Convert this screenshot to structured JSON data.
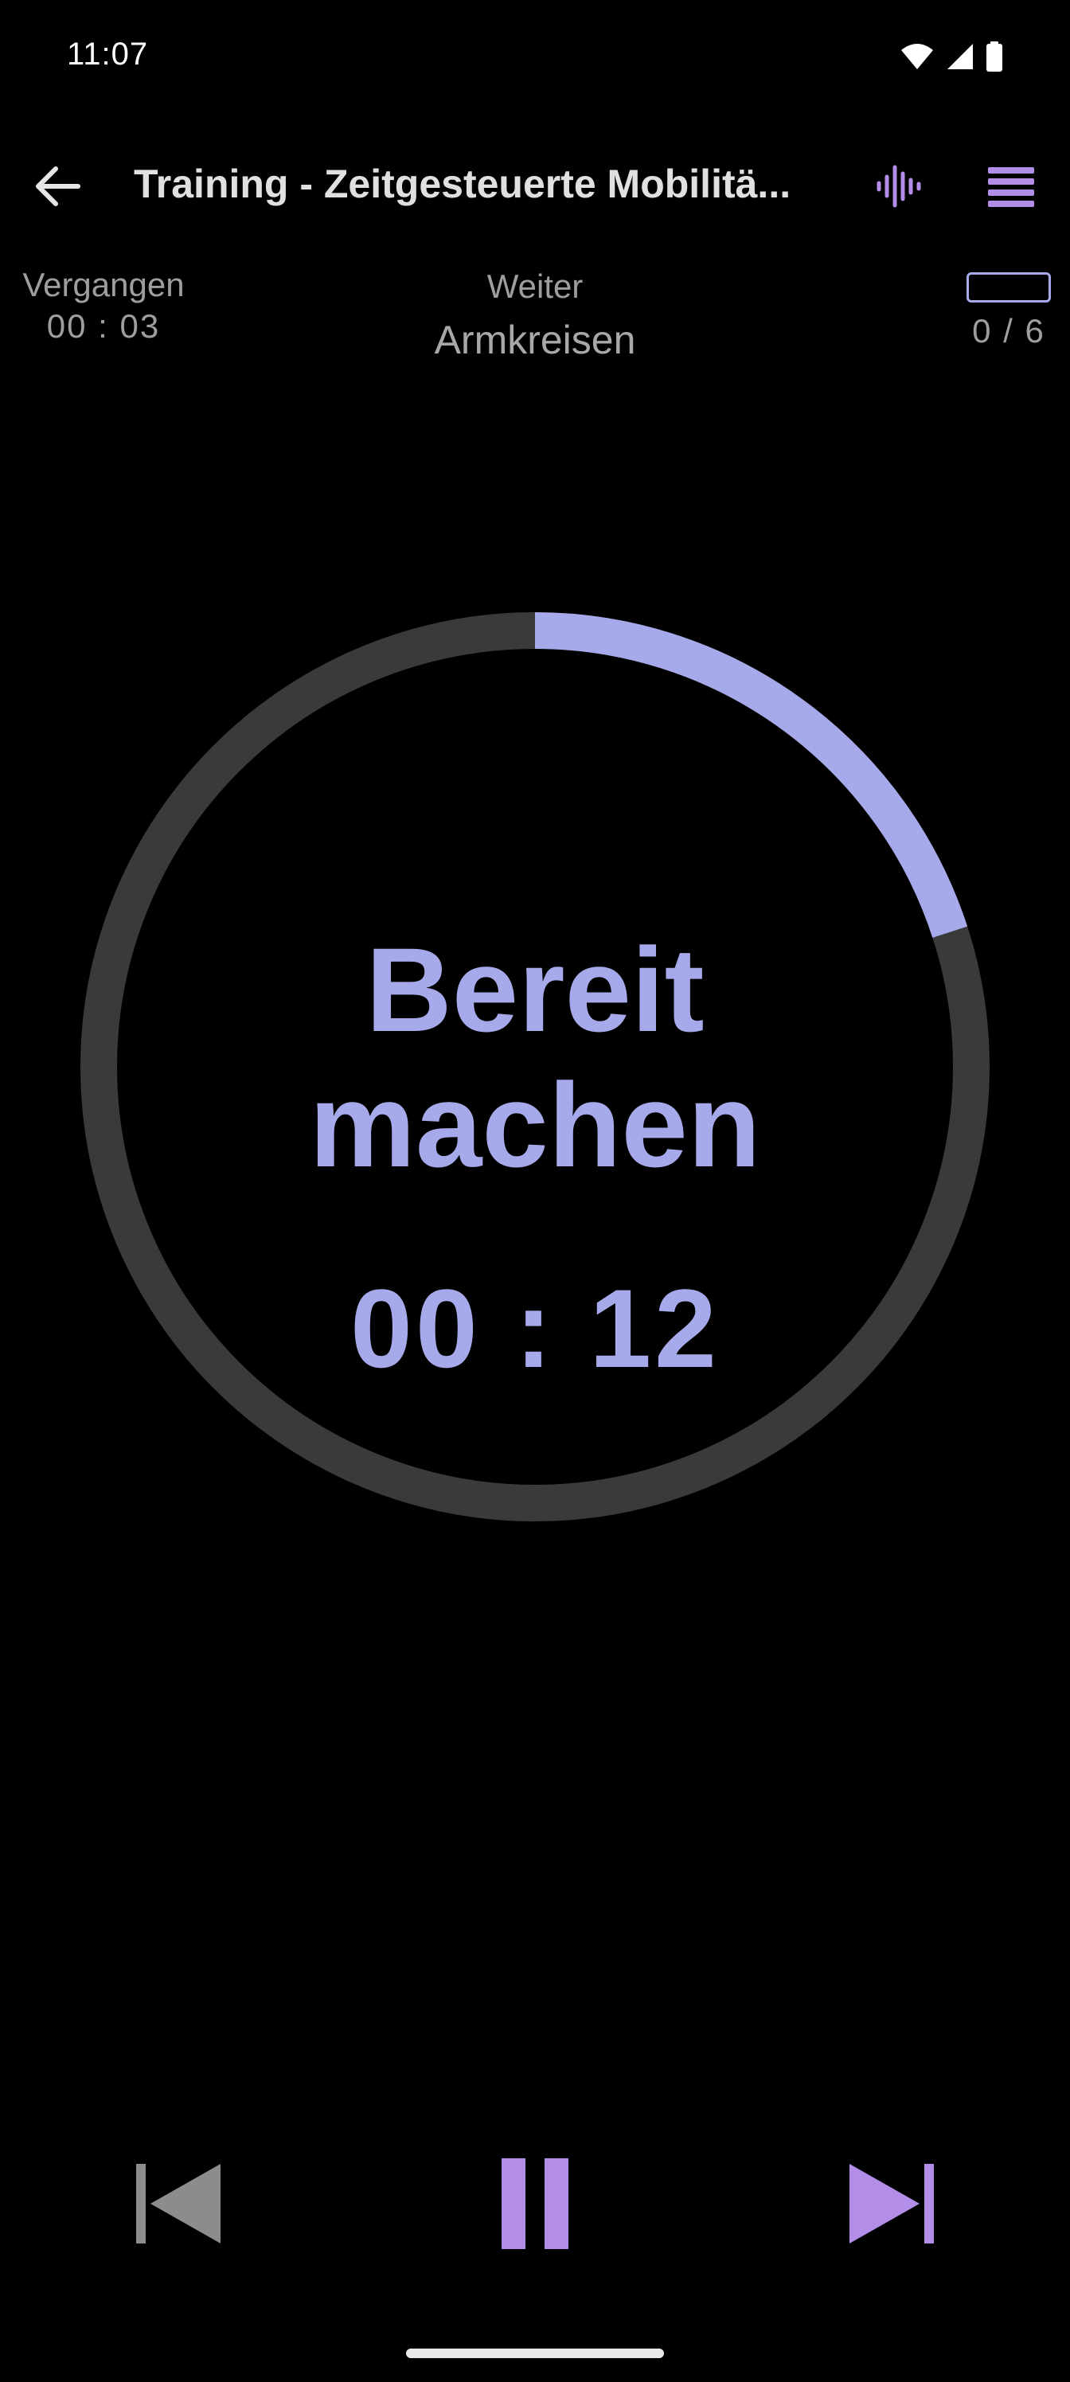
{
  "status_bar": {
    "time": "11:07",
    "icons": [
      "wifi-icon",
      "cellular-signal-icon",
      "battery-icon"
    ]
  },
  "toolbar": {
    "back_icon": "arrow-back-icon",
    "title": "Training - Zeitgesteuerte Mobilitä...",
    "sound_icon": "sound-wave-icon",
    "menu_icon": "menu-list-icon"
  },
  "info": {
    "elapsed_label": "Vergangen",
    "elapsed_value": "00 : 03",
    "next_label": "Weiter",
    "next_exercise": "Armkreisen",
    "progress_text": "0 / 6",
    "progress_fraction": 0
  },
  "timer": {
    "phase_line1": "Bereit",
    "phase_line2": "machen",
    "countdown": "00 : 12",
    "elapsed_fraction": 0.2
  },
  "controls": {
    "previous_icon": "skip-previous-icon",
    "pause_icon": "pause-icon",
    "next_icon": "skip-next-icon"
  },
  "colors": {
    "accent": "#a6aaea",
    "accent_purple": "#b28ee8",
    "ring_track": "#3a3a3a",
    "background": "#000000",
    "muted_text": "#9e9e9e",
    "disabled": "#8c8c8c"
  }
}
